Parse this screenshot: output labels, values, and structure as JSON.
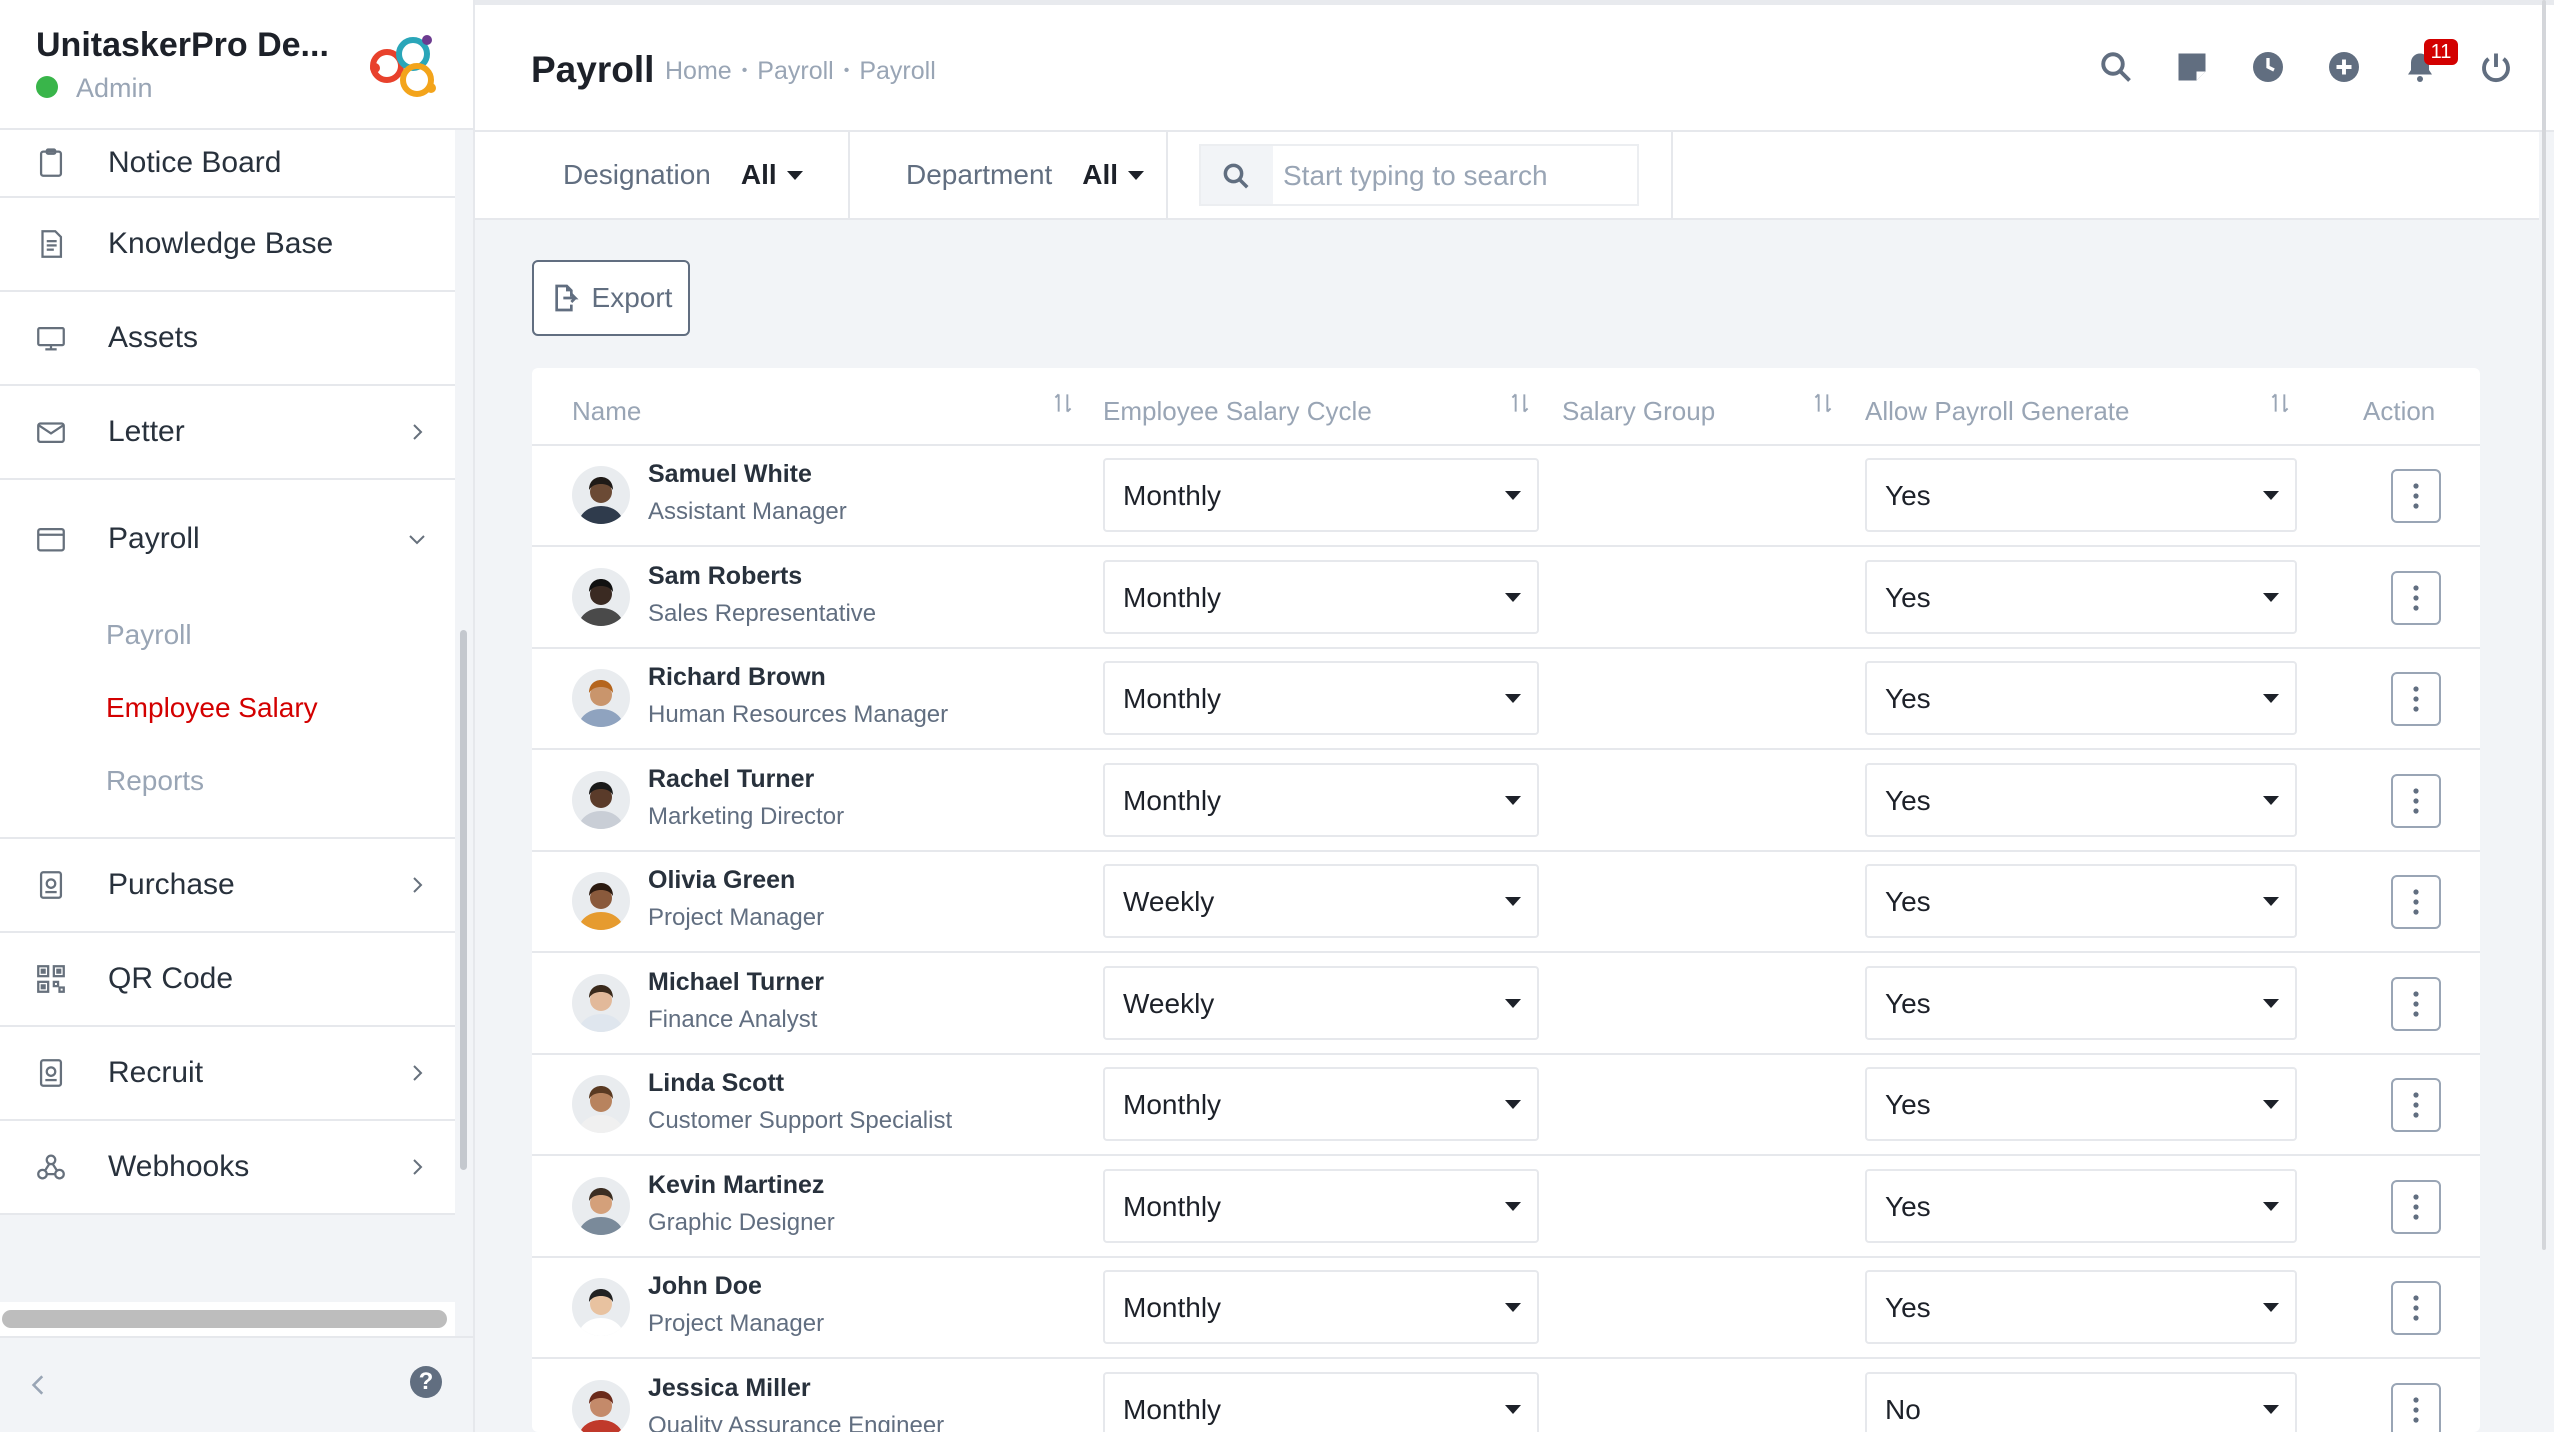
{
  "app": {
    "company_name": "UnitaskerPro De...",
    "user_role": "Admin",
    "brand_color": "#d30000"
  },
  "sidebar": {
    "items": [
      {
        "label": "Notice Board",
        "icon": "clipboard-icon"
      },
      {
        "label": "Knowledge Base",
        "icon": "document-icon"
      },
      {
        "label": "Assets",
        "icon": "monitor-icon"
      },
      {
        "label": "Letter",
        "icon": "envelope-icon"
      },
      {
        "label": "Payroll",
        "icon": "wallet-icon"
      },
      {
        "label": "Purchase",
        "icon": "badge-icon"
      },
      {
        "label": "QR Code",
        "icon": "qr-code-icon"
      },
      {
        "label": "Recruit",
        "icon": "badge-icon"
      },
      {
        "label": "Webhooks",
        "icon": "webhook-icon"
      }
    ],
    "payroll_submenu": [
      {
        "label": "Payroll",
        "active": false
      },
      {
        "label": "Employee Salary",
        "active": true
      },
      {
        "label": "Reports",
        "active": false
      }
    ]
  },
  "header": {
    "title": "Payroll",
    "breadcrumb": [
      "Home",
      "Payroll",
      "Payroll"
    ],
    "notification_count": "11",
    "icons": [
      "search-icon",
      "sticky-note-icon",
      "clock-icon",
      "add-circle-icon",
      "bell-icon",
      "power-icon"
    ]
  },
  "filters": {
    "designation_label": "Designation",
    "designation_value": "All",
    "department_label": "Department",
    "department_value": "All",
    "search_placeholder": "Start typing to search"
  },
  "toolbar": {
    "export_label": "Export"
  },
  "table": {
    "columns": [
      "Name",
      "Employee Salary Cycle",
      "Salary Group",
      "Allow Payroll Generate",
      "Action"
    ],
    "rows": [
      {
        "name": "Samuel White",
        "designation": "Assistant Manager",
        "salary_cycle": "Monthly",
        "salary_group": "",
        "allow_payroll": "Yes"
      },
      {
        "name": "Sam Roberts",
        "designation": "Sales Representative",
        "salary_cycle": "Monthly",
        "salary_group": "",
        "allow_payroll": "Yes"
      },
      {
        "name": "Richard Brown",
        "designation": "Human Resources Manager",
        "salary_cycle": "Monthly",
        "salary_group": "",
        "allow_payroll": "Yes"
      },
      {
        "name": "Rachel Turner",
        "designation": "Marketing Director",
        "salary_cycle": "Monthly",
        "salary_group": "",
        "allow_payroll": "Yes"
      },
      {
        "name": "Olivia Green",
        "designation": "Project Manager",
        "salary_cycle": "Weekly",
        "salary_group": "",
        "allow_payroll": "Yes"
      },
      {
        "name": "Michael Turner",
        "designation": "Finance Analyst",
        "salary_cycle": "Weekly",
        "salary_group": "",
        "allow_payroll": "Yes"
      },
      {
        "name": "Linda Scott",
        "designation": "Customer Support Specialist",
        "salary_cycle": "Monthly",
        "salary_group": "",
        "allow_payroll": "Yes"
      },
      {
        "name": "Kevin Martinez",
        "designation": "Graphic Designer",
        "salary_cycle": "Monthly",
        "salary_group": "",
        "allow_payroll": "Yes"
      },
      {
        "name": "John Doe",
        "designation": "Project Manager",
        "salary_cycle": "Monthly",
        "salary_group": "",
        "allow_payroll": "Yes"
      },
      {
        "name": "Jessica Miller",
        "designation": "Quality Assurance Engineer",
        "salary_cycle": "Monthly",
        "salary_group": "",
        "allow_payroll": "No"
      }
    ]
  }
}
